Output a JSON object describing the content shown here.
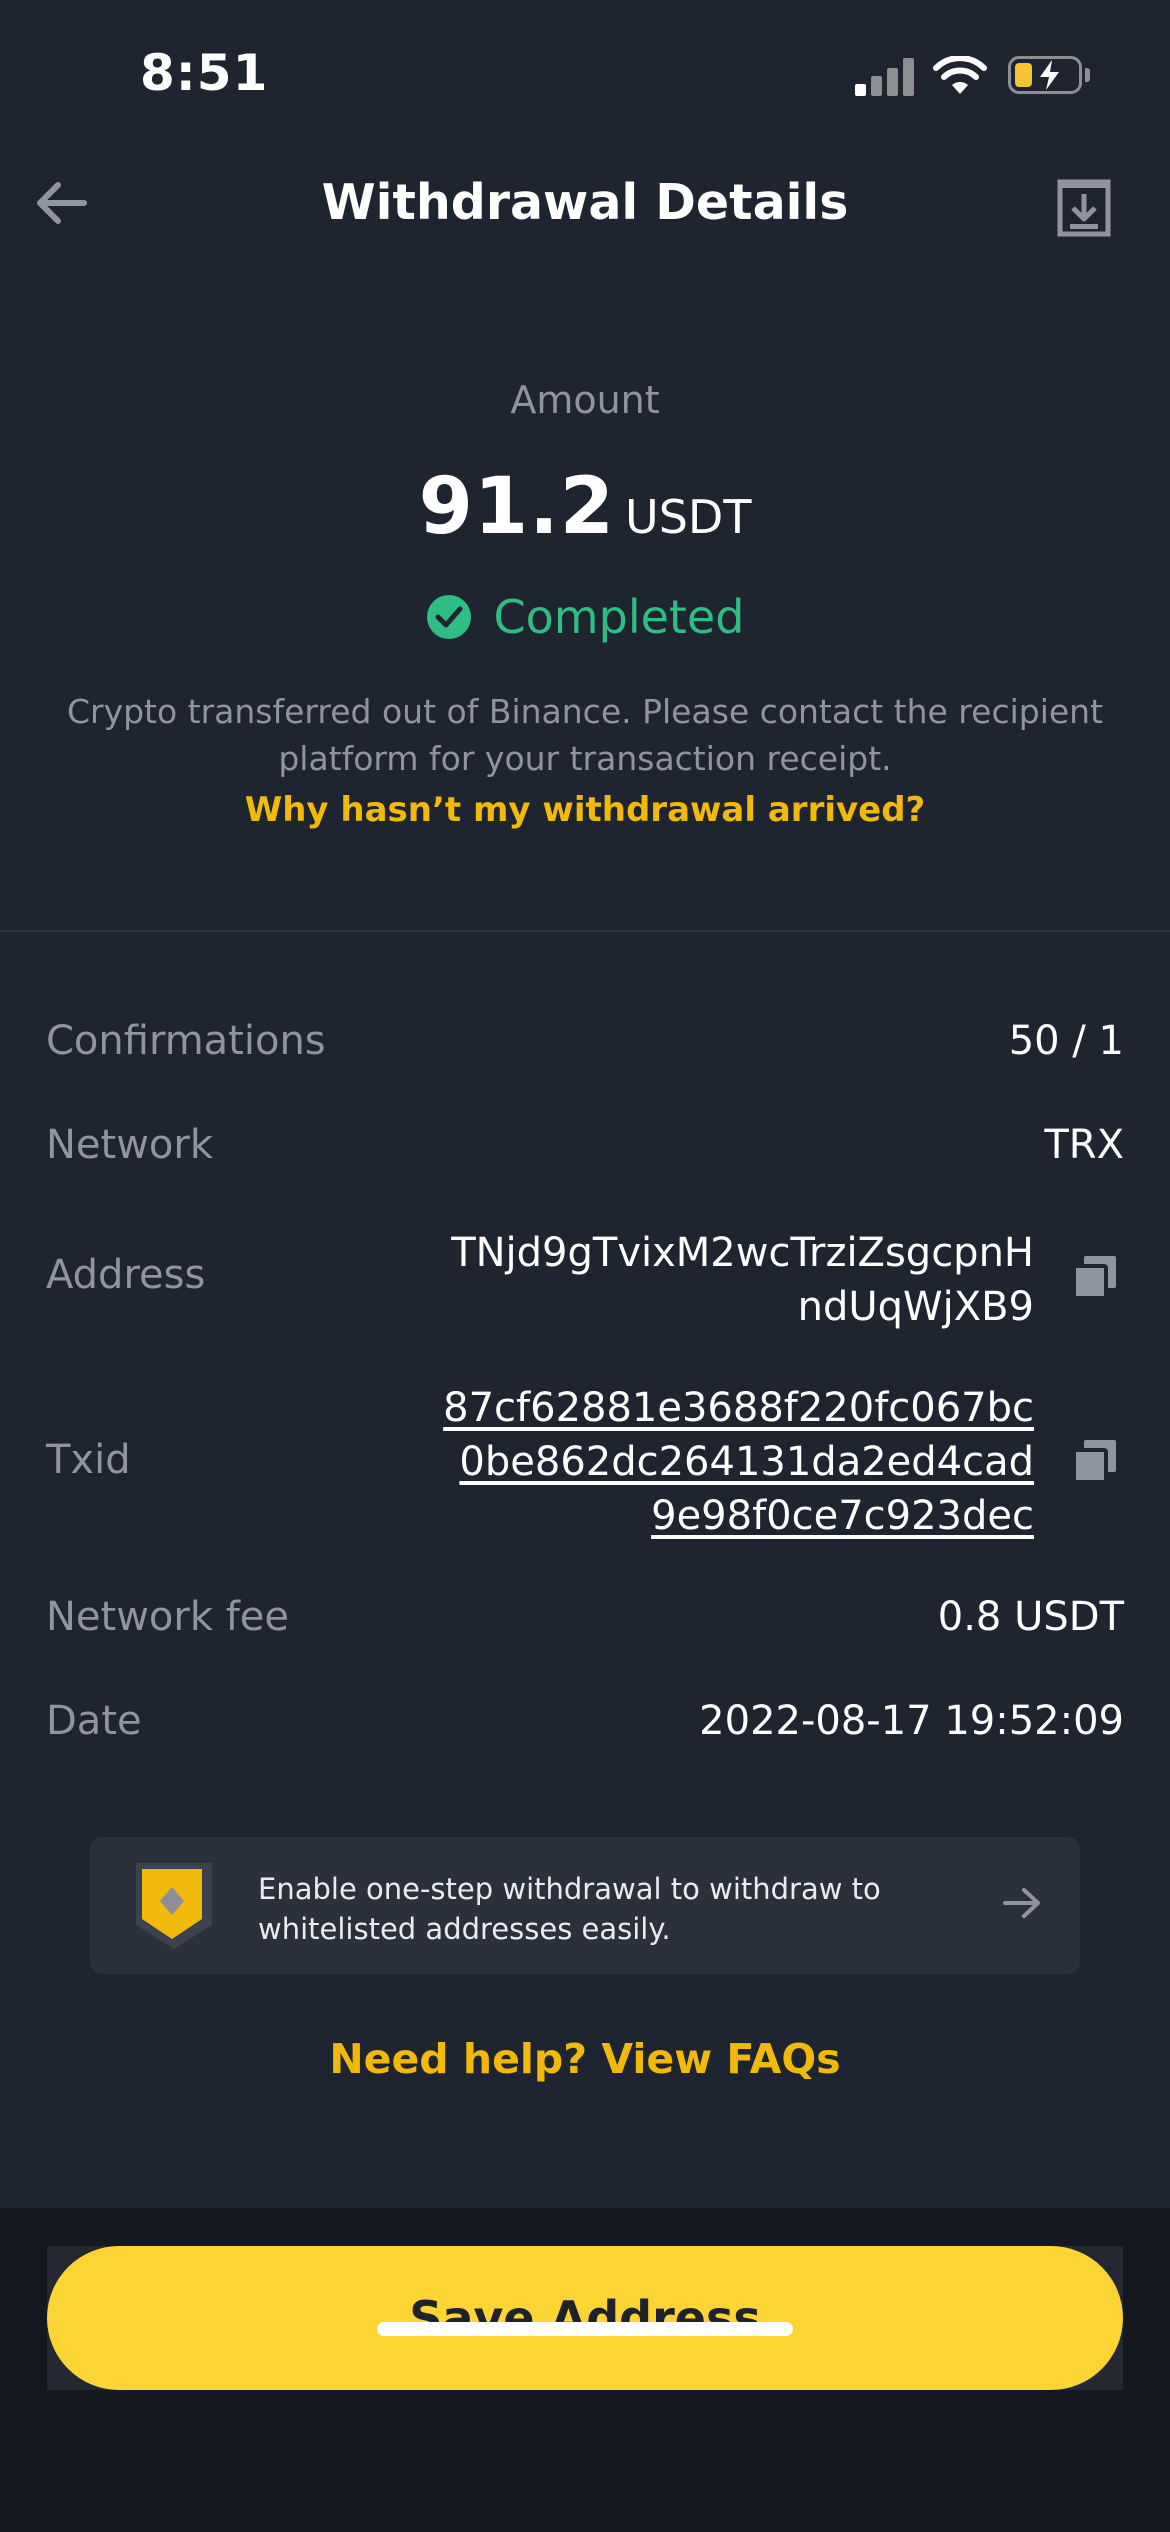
{
  "status_bar": {
    "time": "8:51"
  },
  "header": {
    "title": "Withdrawal Details"
  },
  "summary": {
    "amount_label": "Amount",
    "amount_value": "91.2",
    "amount_unit": "USDT",
    "status": "Completed",
    "description": "Crypto transferred out of Binance. Please contact the recipient platform for your transaction receipt.",
    "help_link": "Why hasn’t my withdrawal arrived?"
  },
  "details": {
    "confirmations_label": "Confirmations",
    "confirmations_value": "50 / 1",
    "network_label": "Network",
    "network_value": "TRX",
    "address_label": "Address",
    "address_value": "TNjd9gTvixM2wcTrziZsgcpnHndUqWjXB9",
    "txid_label": "Txid",
    "txid_value": "87cf62881e3688f220fc067bc0be862dc264131da2ed4cad9e98f0ce7c923dec",
    "fee_label": "Network fee",
    "fee_value": "0.8 USDT",
    "date_label": "Date",
    "date_value": "2022-08-17 19:52:09"
  },
  "banner": {
    "text": "Enable one-step withdrawal to withdraw to whitelisted addresses easily."
  },
  "faq_link": "Need help? View FAQs",
  "footer": {
    "save_label": "Save Address"
  },
  "colors": {
    "background": "#1f2431",
    "accent": "#f0b90b",
    "button": "#fcd535",
    "success": "#2ebd85",
    "muted_text": "#8f959f"
  },
  "icons": [
    "back-arrow-icon",
    "download-icon",
    "check-circle-icon",
    "copy-icon",
    "shield-icon",
    "arrow-right-icon",
    "signal-icon",
    "wifi-icon",
    "battery-icon"
  ]
}
